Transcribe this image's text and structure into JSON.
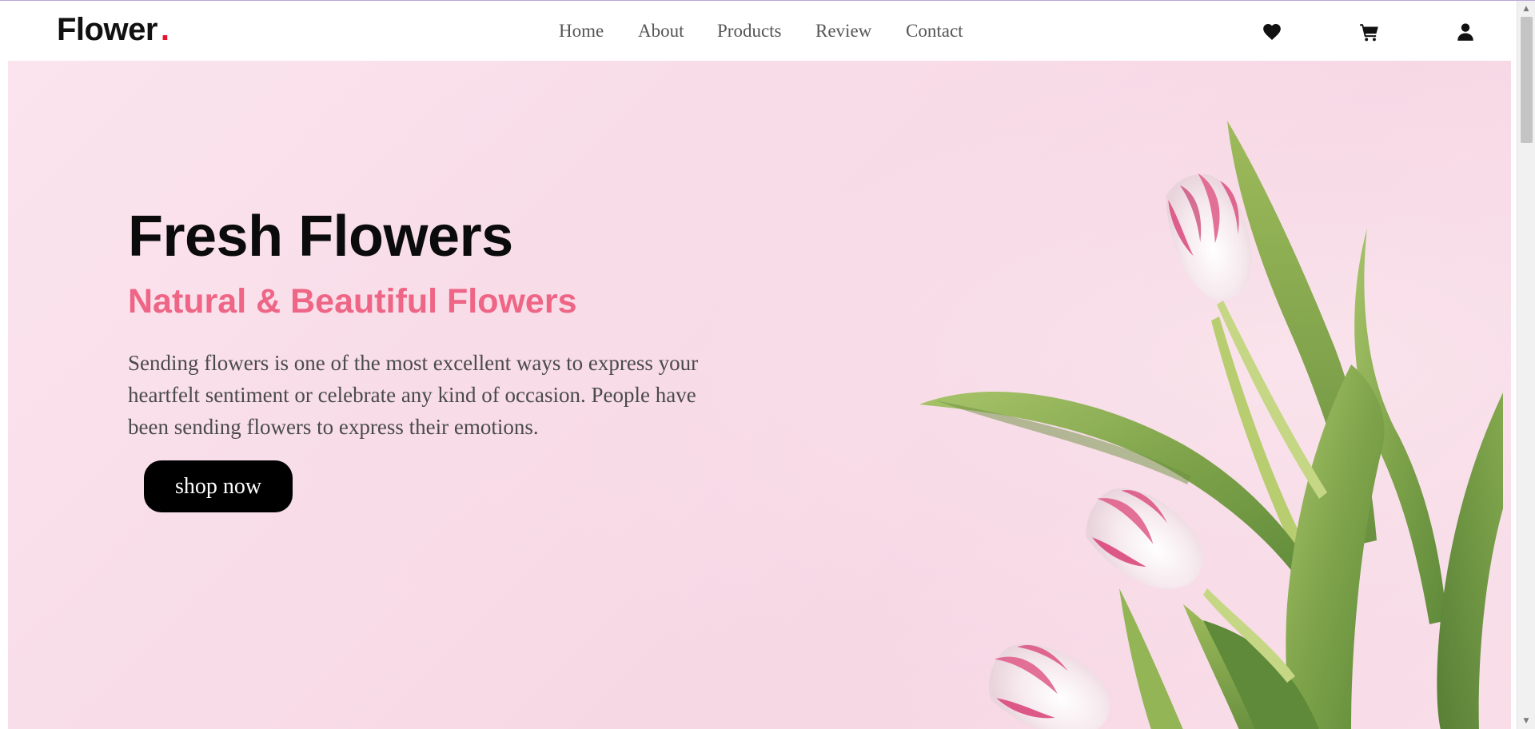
{
  "header": {
    "logo_text": "Flower",
    "logo_dot": ".",
    "nav": [
      {
        "label": "Home"
      },
      {
        "label": "About"
      },
      {
        "label": "Products"
      },
      {
        "label": "Review"
      },
      {
        "label": "Contact"
      }
    ],
    "icons": [
      "heart-icon",
      "cart-icon",
      "user-icon"
    ]
  },
  "hero": {
    "title": "Fresh Flowers",
    "subtitle": "Natural & Beautiful Flowers",
    "description": "Sending flowers is one of the most excellent ways to express your heartfelt sentiment or celebrate any kind of occasion. People have been sending flowers to express their emotions.",
    "button_label": "shop now",
    "image": "pink-white-tulips"
  },
  "colors": {
    "accent": "#ee6585",
    "logo_dot": "#e8132e",
    "hero_background": "#f8dde8",
    "button": "#000000",
    "nav_text": "#555555"
  }
}
